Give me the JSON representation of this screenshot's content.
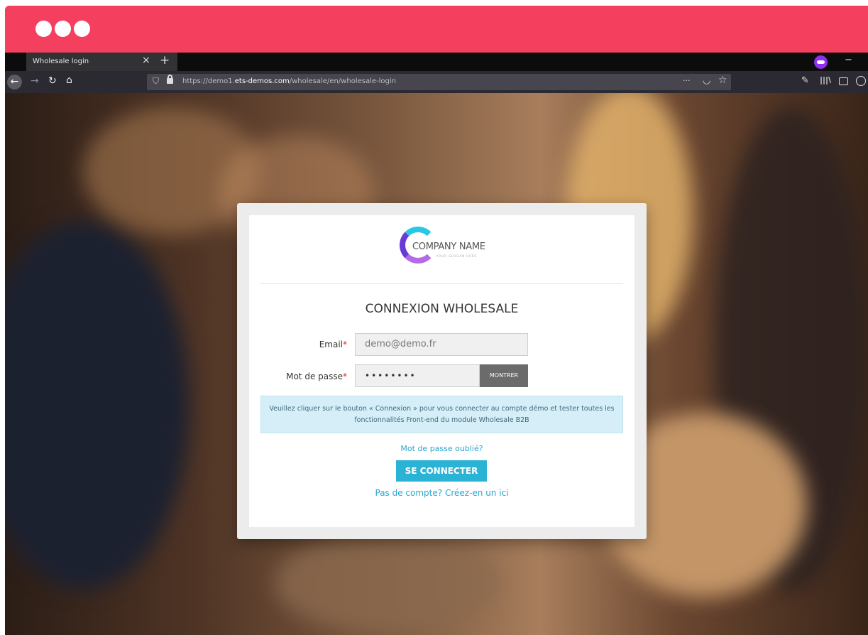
{
  "browser": {
    "tab_title": "Wholesale login",
    "tab_close": "×",
    "new_tab": "+",
    "window_minimize": "−",
    "url_prefix": "https://demo1.",
    "url_domain": "ets-demos.com",
    "url_path": "/wholesale/en/wholesale-login",
    "page_actions": "···",
    "titlebar_color": "#f4405e"
  },
  "form": {
    "company_name": "COMPANY NAME",
    "company_slogan": "YOUR SLOGAN HERE",
    "title": "CONNEXION WHOLESALE",
    "email_label": "Email",
    "email_value": "demo@demo.fr",
    "password_label": "Mot de passe",
    "password_value": "••••••••",
    "required_marker": "*",
    "show_button": "MONTRER",
    "info_text": "Veuillez cliquer sur le bouton « Connexion » pour vous connecter au compte démo et tester toutes les fonctionnalités Front-end du module Wholesale B2B",
    "forgot_password": "Mot de passe oublié?",
    "login_button": "SE CONNECTER",
    "create_account": "Pas de compte? Créez-en un ici",
    "accent_color": "#2bb3d6"
  }
}
